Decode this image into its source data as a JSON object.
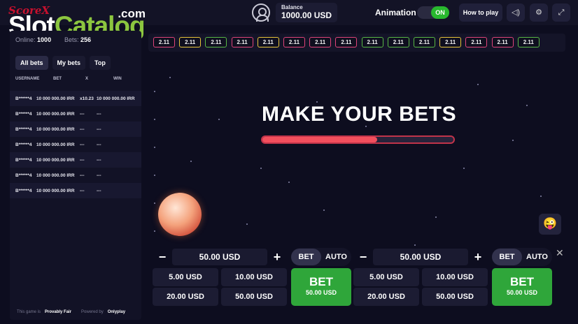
{
  "logo": {
    "score": "ScoreX",
    "slot": "Slot",
    "catalog": "Catalog",
    "dotcom": ".com"
  },
  "header": {
    "balance_label": "Balance",
    "balance_value": "1000.00 USD",
    "animation_label": "Animation",
    "animation_toggle": "ON",
    "how_to_play": "How to play",
    "icons": [
      "user-icon",
      "sound-icon",
      "settings-icon",
      "fullscreen-icon"
    ]
  },
  "sidebar": {
    "online_label": "Online:",
    "online_value": "1000",
    "bets_label": "Bets:",
    "bets_value": "256",
    "tabs": [
      {
        "label": "All bets"
      },
      {
        "label": "My bets"
      },
      {
        "label": "Top"
      }
    ],
    "columns": {
      "user": "USERNAME",
      "bet": "BET",
      "x": "X",
      "win": "WIN"
    },
    "rows": [
      {
        "user": "B******4",
        "bet": "10 000 000.00 IRR",
        "x": "x10.23",
        "win": "10 000 000.00 IRR"
      },
      {
        "user": "B******4",
        "bet": "10 000 000.00 IRR",
        "x": "---",
        "win": "---"
      },
      {
        "user": "B******4",
        "bet": "10 000 000.00 IRR",
        "x": "---",
        "win": "---"
      },
      {
        "user": "B******4",
        "bet": "10 000 000.00 IRR",
        "x": "---",
        "win": "---"
      },
      {
        "user": "B******4",
        "bet": "10 000 000.00 IRR",
        "x": "---",
        "win": "---"
      },
      {
        "user": "B******4",
        "bet": "10 000 000.00 IRR",
        "x": "---",
        "win": "---"
      },
      {
        "user": "B******4",
        "bet": "10 000 000.00 IRR",
        "x": "---",
        "win": "---"
      }
    ],
    "footer_fair_prefix": "This game is",
    "footer_fair": "Provably Fair",
    "footer_powered": "Powered by",
    "footer_brand": "Onlyplay"
  },
  "multipliers": [
    {
      "value": "2.11",
      "color": "#e0447a"
    },
    {
      "value": "2.11",
      "color": "#e8c53a"
    },
    {
      "value": "2.11",
      "color": "#58b845"
    },
    {
      "value": "2.11",
      "color": "#e0447a"
    },
    {
      "value": "2.11",
      "color": "#e8c53a"
    },
    {
      "value": "2.11",
      "color": "#e0447a"
    },
    {
      "value": "2.11",
      "color": "#e0447a"
    },
    {
      "value": "2.11",
      "color": "#e0447a"
    },
    {
      "value": "2.11",
      "color": "#58b845"
    },
    {
      "value": "2.11",
      "color": "#58b845"
    },
    {
      "value": "2.11",
      "color": "#58b845"
    },
    {
      "value": "2.11",
      "color": "#e8c53a"
    },
    {
      "value": "2.11",
      "color": "#e0447a"
    },
    {
      "value": "2.11",
      "color": "#e0447a"
    },
    {
      "value": "2.11",
      "color": "#58b845"
    }
  ],
  "game": {
    "headline": "MAKE YOUR BETS",
    "progress": 0.6,
    "emoji": "😜"
  },
  "bet_panels": [
    {
      "amount": "50.00 USD",
      "mode_bet": "BET",
      "mode_auto": "AUTO",
      "quick": [
        "5.00 USD",
        "10.00 USD",
        "20.00 USD",
        "50.00 USD"
      ],
      "bet_label": "BET",
      "bet_amount": "50.00 USD"
    },
    {
      "amount": "50.00 USD",
      "mode_bet": "BET",
      "mode_auto": "AUTO",
      "quick": [
        "5.00 USD",
        "10.00 USD",
        "20.00 USD",
        "50.00 USD"
      ],
      "bet_label": "BET",
      "bet_amount": "50.00 USD"
    }
  ]
}
